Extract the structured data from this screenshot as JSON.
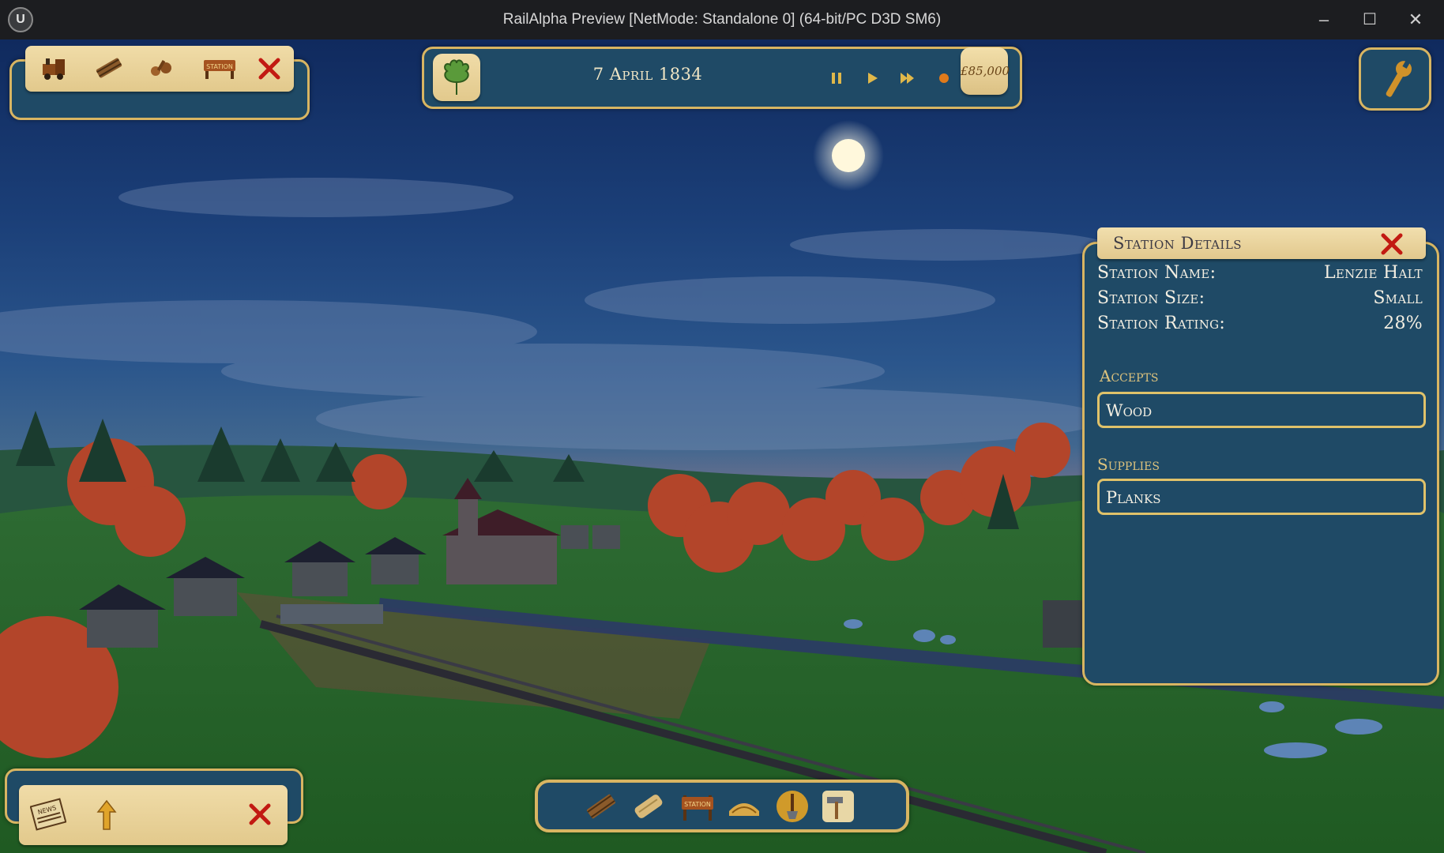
{
  "window": {
    "title": "RailAlpha Preview [NetMode: Standalone 0]  (64-bit/PC D3D SM6)",
    "logo_text": "U",
    "minimize_glyph": "–",
    "maximize_glyph": "☐",
    "close_glyph": "✕"
  },
  "top_left_toolbar": {
    "items": [
      "locomotive-icon",
      "track-icon",
      "construction-icon",
      "station-sign-icon",
      "close-icon"
    ],
    "station_sign_text": "STATION"
  },
  "top_bar": {
    "season_icon": "oak-leaf-icon",
    "date": "7 April 1834",
    "controls": [
      "pause-icon",
      "play-icon",
      "fast-forward-icon",
      "record-icon"
    ],
    "money": "£85,000"
  },
  "settings": {
    "icon": "wrench-icon"
  },
  "station_details": {
    "header": "Station Details",
    "rows": [
      {
        "label": "Station Name:",
        "value": "Lenzie Halt"
      },
      {
        "label": "Station Size:",
        "value": "Small"
      },
      {
        "label": "Station Rating:",
        "value": "28%"
      }
    ],
    "accepts_label": "Accepts",
    "accepts": [
      "Wood"
    ],
    "supplies_label": "Supplies",
    "supplies": [
      "Planks"
    ]
  },
  "bottom_left_toolbar": {
    "items": [
      "newspaper-icon",
      "up-arrow-icon",
      "close-icon"
    ],
    "newspaper_text": "NEWS"
  },
  "bottom_toolbar": {
    "items": [
      "track-icon",
      "plank-icon",
      "station-sign-icon",
      "bridge-icon",
      "shovel-icon",
      "hammer-icon"
    ],
    "station_sign_text": "STATION"
  },
  "colors": {
    "panel_blue": "#1f4a66",
    "panel_border": "#d8b562",
    "parchment": "#ead39a",
    "close_red": "#c21a12"
  }
}
